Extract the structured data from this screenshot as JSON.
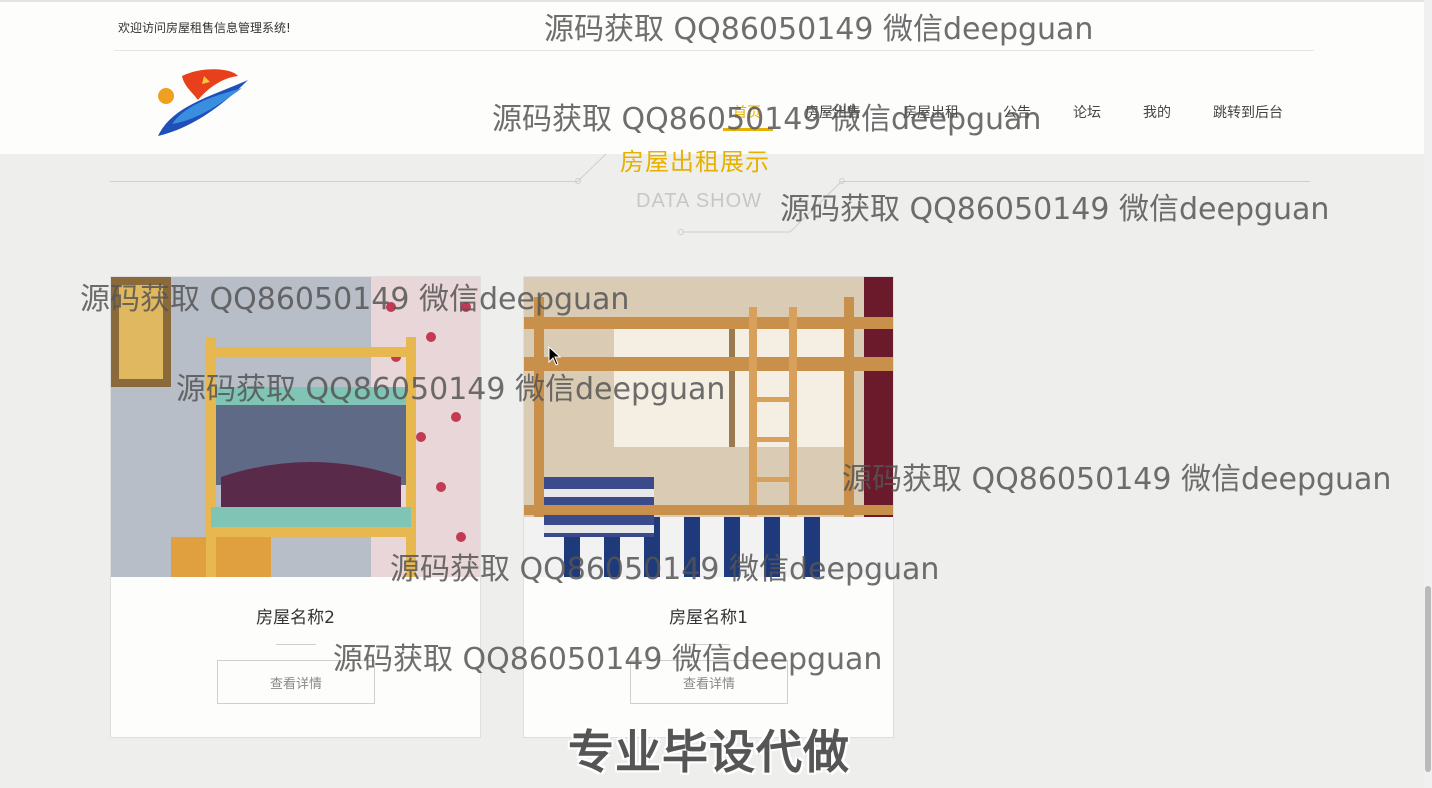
{
  "header": {
    "welcome_text": "欢迎访问房屋租售信息管理系统!",
    "nav": [
      {
        "label": "首页",
        "active": true
      },
      {
        "label": "房屋出售",
        "active": false
      },
      {
        "label": "房屋出租",
        "active": false
      },
      {
        "label": "公告",
        "active": false
      },
      {
        "label": "论坛",
        "active": false
      },
      {
        "label": "我的",
        "active": false
      },
      {
        "label": "跳转到后台",
        "active": false
      }
    ],
    "accent_color": "#e6b100"
  },
  "section": {
    "title": "房屋出租展示",
    "subtitle": "DATA SHOW"
  },
  "cards": [
    {
      "name": "房屋名称2",
      "button_label": "查看详情",
      "image": "bunk-bed-room-photo"
    },
    {
      "name": "房屋名称1",
      "button_label": "查看详情",
      "image": "bunk-bed-window-photo"
    }
  ],
  "watermarks": {
    "text": "源码获取 QQ86050149 微信deepguan",
    "banner": "专业毕设代做"
  }
}
